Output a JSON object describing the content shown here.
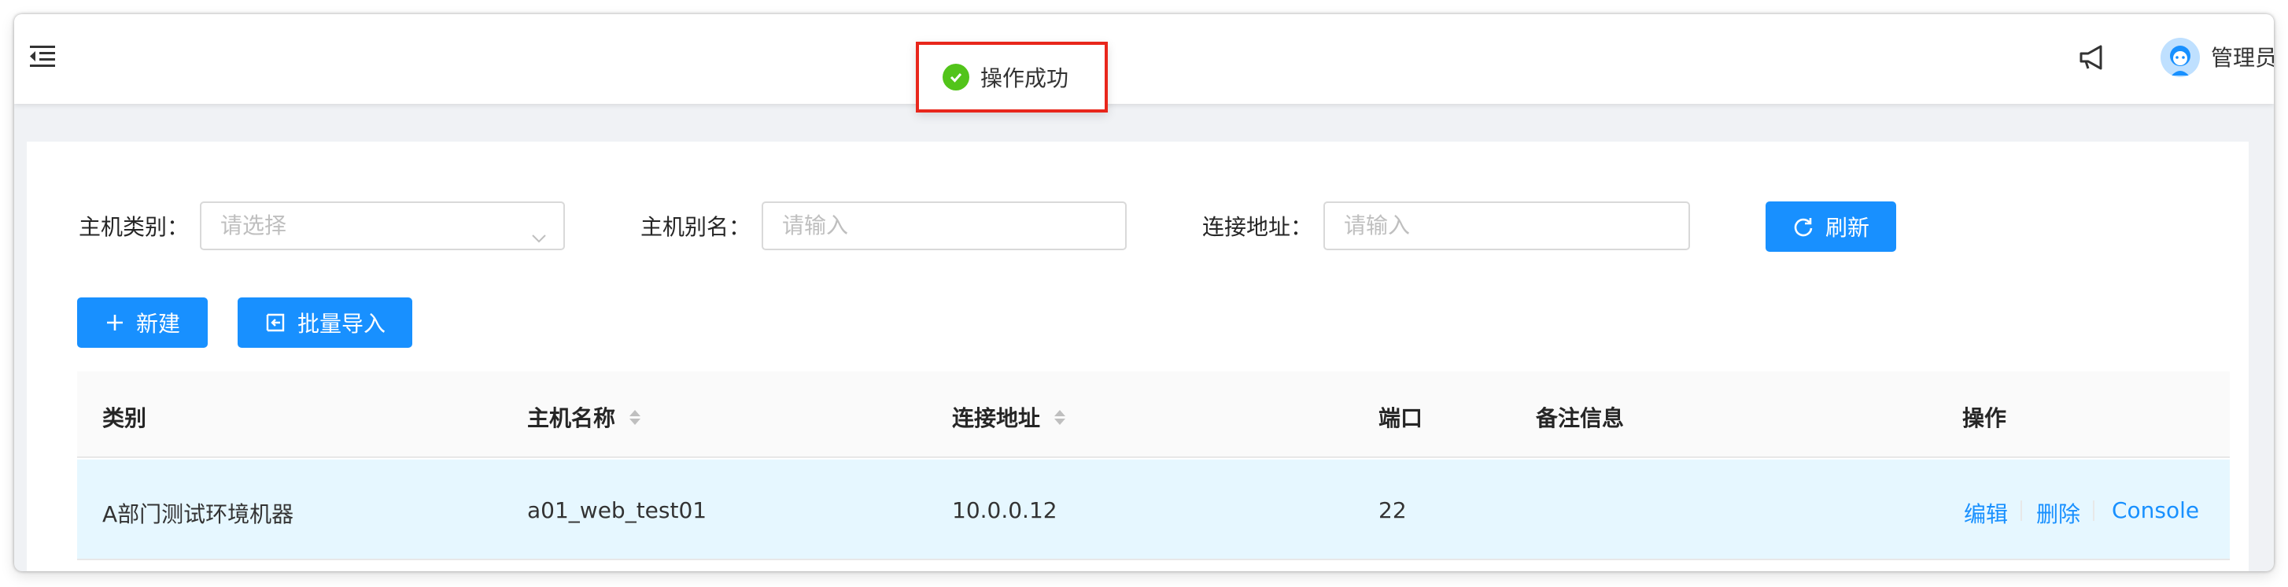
{
  "header": {
    "user_name": "管理员",
    "icons": [
      "menu-fold-icon",
      "notification-icon",
      "avatar"
    ]
  },
  "toast": {
    "message": "操作成功",
    "status_color": "#52c41a"
  },
  "filters": {
    "host_type": {
      "label": "主机类别：",
      "placeholder": "请选择"
    },
    "host_alias": {
      "label": "主机别名：",
      "placeholder": "请输入"
    },
    "address": {
      "label": "连接地址：",
      "placeholder": "请输入"
    },
    "refresh_label": "刷新"
  },
  "toolbar": {
    "new_label": "新建",
    "batch_import_label": "批量导入"
  },
  "table": {
    "columns": [
      "类别",
      "主机名称",
      "连接地址",
      "端口",
      "备注信息",
      "操作"
    ],
    "sortable_columns": [
      "主机名称",
      "连接地址"
    ],
    "rows": [
      {
        "category": "A部门测试环境机器",
        "hostname": "a01_web_test01",
        "address": "10.0.0.12",
        "port": "22",
        "remark": "",
        "actions": [
          "编辑",
          "删除",
          "Console"
        ]
      }
    ]
  },
  "colors": {
    "primary": "#1890ff",
    "highlight_row": "#e6f7ff",
    "toast_border": "#e8261b"
  }
}
